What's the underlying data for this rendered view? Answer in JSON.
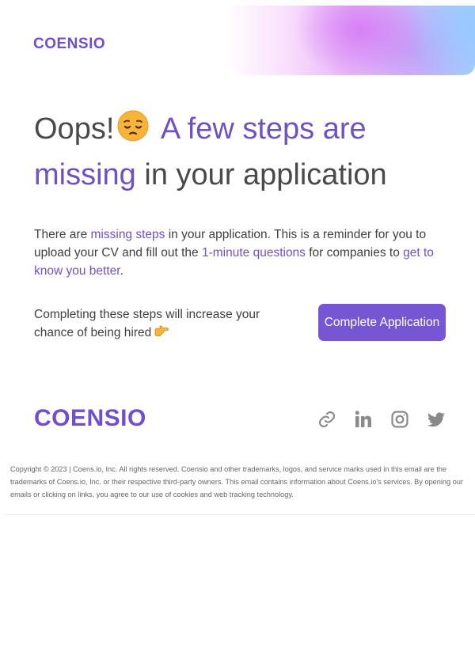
{
  "brand": {
    "name": "COENSIO",
    "color": "#6f4fcf",
    "accent_text": "#6f52c2",
    "button_color": "#7756d4"
  },
  "headline": {
    "part1": "Oops!",
    "emoji_icon": "pensive-face-icon",
    "part2": "A few steps are missing",
    "part3": "in your application"
  },
  "body": {
    "t1": "There are ",
    "link1": "missing steps",
    "t2": " in your application. This is a reminder for you to upload your CV and fill out the ",
    "link2": "1-minute questions",
    "t3": " for companies to ",
    "link3": "get to know you better",
    "t4": "."
  },
  "cta": {
    "text": "Completing these steps will increase your chance of being hired",
    "emoji_icon": "pointing-right-icon",
    "button_label": "Complete Application"
  },
  "footer": {
    "logo": "COENSIO",
    "social_icons": [
      "link-icon",
      "linkedin-icon",
      "instagram-icon",
      "twitter-icon"
    ],
    "copyright": "Copyright © 2023 | Coens.io, Inc. All rights reserved. Coensio and other trademarks, logos, and service marks used in this email are the trademarks of Coens.io, Inc. or their respective third-party owners. This email contains information about Coens.io's services. By opening our emails or clicking on links, you agree to our use of cookies and web tracking technology."
  }
}
